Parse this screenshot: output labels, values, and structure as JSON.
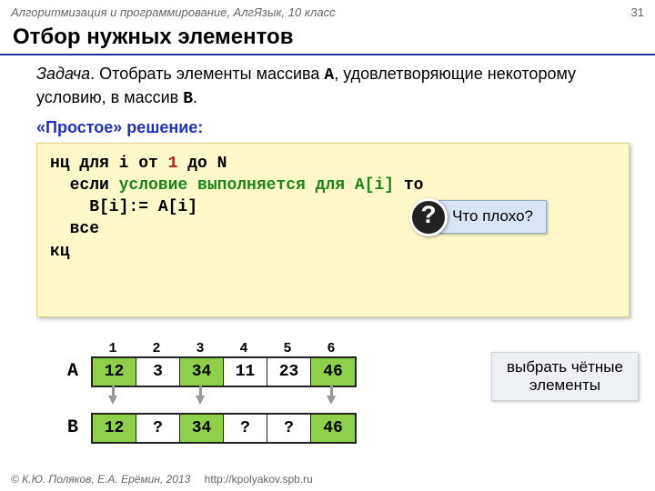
{
  "header": {
    "course": "Алгоритмизация и программирование, АлгЯзык, 10 класс",
    "page": "31"
  },
  "title": "Отбор нужных элементов",
  "task": {
    "label": "Задача",
    "text_before": ". Отобрать элементы массива ",
    "arrA": "A",
    "text_mid": ", удовлетворяющие некоторому условию, в массив ",
    "arrB": "B",
    "text_after": "."
  },
  "subhead": "«Простое» решение:",
  "code": {
    "l1a": "нц для i от ",
    "l1num": "1",
    "l1b": " до N",
    "l2a": "  если ",
    "l2cond": "условие выполняется для A[i]",
    "l2b": " то",
    "l3": "    B[i]:= A[i]",
    "l4": "  все",
    "l5": "кц"
  },
  "callout": {
    "q": "?",
    "text": "Что плохо?"
  },
  "arrays": {
    "indices": [
      "1",
      "2",
      "3",
      "4",
      "5",
      "6"
    ],
    "A": {
      "label": "A",
      "cells": [
        {
          "v": "12",
          "even": true
        },
        {
          "v": "3",
          "even": false
        },
        {
          "v": "34",
          "even": true
        },
        {
          "v": "11",
          "even": false
        },
        {
          "v": "23",
          "even": false
        },
        {
          "v": "46",
          "even": true
        }
      ]
    },
    "arrows": [
      true,
      false,
      true,
      false,
      false,
      true
    ],
    "B": {
      "label": "B",
      "cells": [
        {
          "v": "12",
          "even": true
        },
        {
          "v": "?",
          "even": false
        },
        {
          "v": "34",
          "even": true
        },
        {
          "v": "?",
          "even": false
        },
        {
          "v": "?",
          "even": false
        },
        {
          "v": "46",
          "even": true
        }
      ]
    },
    "note_l1": "выбрать чётные",
    "note_l2": "элементы"
  },
  "footer": {
    "copy": "© К.Ю. Поляков, Е.А. Ерёмин, 2013",
    "url": "http://kpolyakov.spb.ru"
  }
}
